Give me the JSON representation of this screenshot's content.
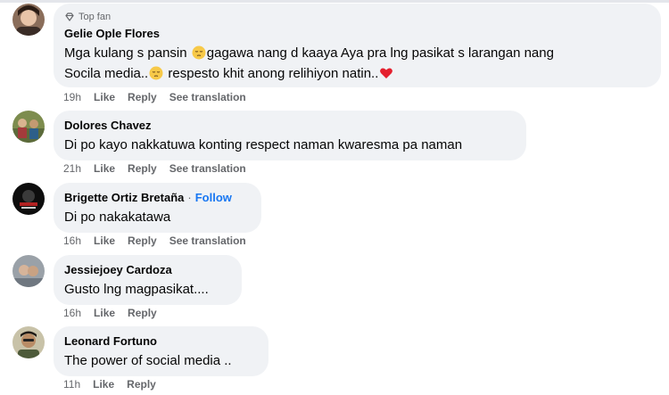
{
  "comments": [
    {
      "badge": "Top fan",
      "author": "Gelie Ople Flores",
      "line1_a": "Mga kulang s pansin",
      "line1_b": "gagawa nang d kaaya Aya pra lng pasikat s larangan nang",
      "line2_a": "Socila media..",
      "line2_b": "respesto khit anong relihiyon natin..",
      "emoji1": "pensive-face-emoji",
      "emoji2": "pensive-face-emoji",
      "emoji3": "red-heart-emoji",
      "time": "19h",
      "like": "Like",
      "reply": "Reply",
      "translate": "See translation"
    },
    {
      "author": "Dolores Chavez",
      "text": "Di po kayo nakkatuwa konting respect naman kwaresma pa naman",
      "time": "21h",
      "like": "Like",
      "reply": "Reply",
      "translate": "See translation"
    },
    {
      "author": "Brigette Ortiz Bretaña",
      "follow_sep": "·",
      "follow": "Follow",
      "text": "Di po nakakatawa",
      "time": "16h",
      "like": "Like",
      "reply": "Reply",
      "translate": "See translation"
    },
    {
      "author": "Jessiejoey Cardoza",
      "text": "Gusto lng magpasikat....",
      "time": "16h",
      "like": "Like",
      "reply": "Reply"
    },
    {
      "author": "Leonard Fortuno",
      "text": "The power of social media ..",
      "time": "11h",
      "like": "Like",
      "reply": "Reply"
    }
  ],
  "colors": {
    "bubble": "#f0f2f5",
    "meta": "#65676b",
    "link": "#1877f2",
    "heart": "#e4202e"
  }
}
